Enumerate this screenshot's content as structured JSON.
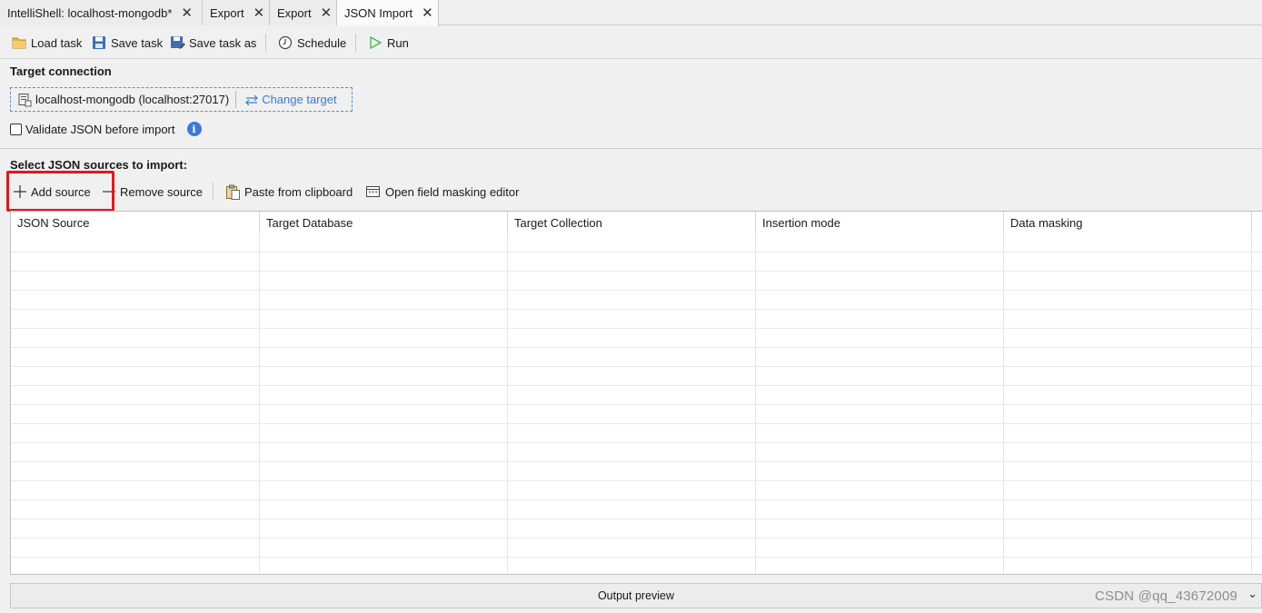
{
  "tabs": [
    {
      "label": "IntelliShell: localhost-mongodb*",
      "close": "✕"
    },
    {
      "label": "Export",
      "close": "✕"
    },
    {
      "label": "Export",
      "close": "✕"
    },
    {
      "label": "JSON Import",
      "close": "✕",
      "active": true
    }
  ],
  "toolbar": {
    "load_task": "Load task",
    "save_task": "Save task",
    "save_task_as": "Save task as",
    "schedule": "Schedule",
    "run": "Run"
  },
  "target": {
    "section_title": "Target connection",
    "connection": "localhost-mongodb (localhost:27017)",
    "change_target": "Change target"
  },
  "validate": {
    "label": "Validate JSON before import",
    "checked": false,
    "info_glyph": "i"
  },
  "sources": {
    "section_title": "Select JSON sources to import:",
    "add_source": "Add source",
    "remove_source": "Remove source",
    "paste_from_clipboard": "Paste from clipboard",
    "open_field_masking_editor": "Open field masking editor"
  },
  "grid": {
    "columns": [
      "JSON Source",
      "Target Database",
      "Target Collection",
      "Insertion mode",
      "Data masking"
    ],
    "rows": []
  },
  "output_preview": {
    "label": "Output preview",
    "chevron": "⌄"
  },
  "watermark": "CSDN @qq_43672009",
  "colors": {
    "accent": "#3a7bd5",
    "highlight": "#e8141f",
    "run_green": "#4caf50"
  }
}
